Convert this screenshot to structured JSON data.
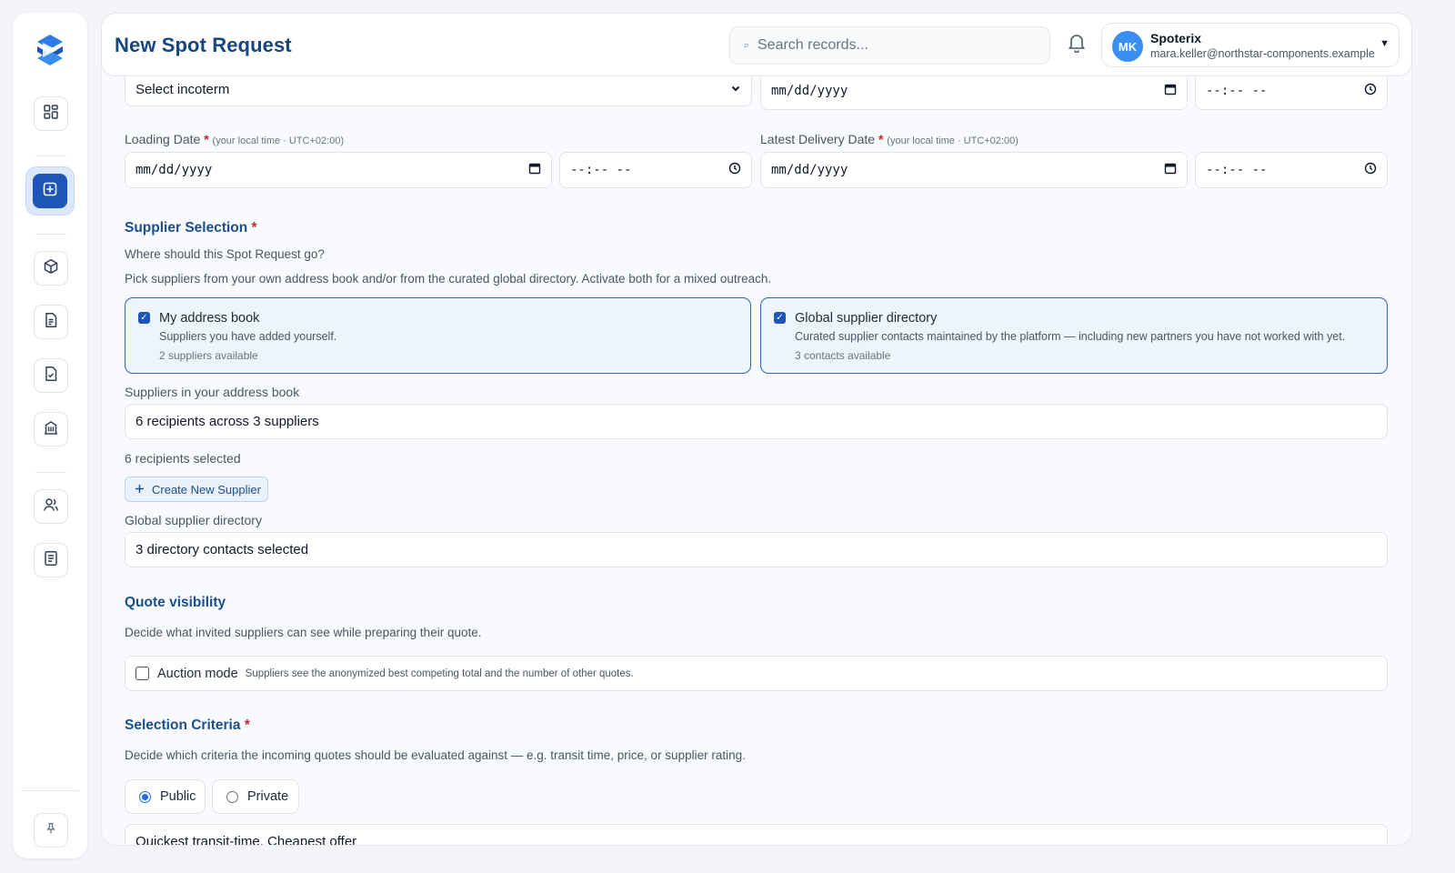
{
  "header": {
    "title": "New Spot Request",
    "search_placeholder": "Search records...",
    "user": {
      "initials": "MK",
      "name": "Spoterix",
      "email": "mara.keller@northstar-components.example"
    }
  },
  "sidebar": {
    "items": [
      {
        "icon": "dashboard-icon"
      },
      {
        "icon": "new-request-icon",
        "active": true
      },
      {
        "icon": "package-icon"
      },
      {
        "icon": "document-icon"
      },
      {
        "icon": "document-check-icon"
      },
      {
        "icon": "building-icon"
      },
      {
        "icon": "users-icon"
      },
      {
        "icon": "list-icon"
      },
      {
        "icon": "pin-icon"
      }
    ]
  },
  "form": {
    "incoterm_placeholder": "Select incoterm",
    "date_placeholder": "mm/dd/yyyy",
    "time_placeholder": "--:-- --",
    "loading_date_label": "Loading Date",
    "latest_delivery_label": "Latest Delivery Date",
    "required_mark": "*",
    "timezone_note": "(your local time · UTC+02:00)",
    "supplier_selection": {
      "title": "Supplier Selection",
      "question": "Where should this Spot Request go?",
      "help": "Pick suppliers from your own address book and/or from the curated global directory. Activate both for a mixed outreach.",
      "address_book": {
        "title": "My address book",
        "subtitle": "Suppliers you have added yourself.",
        "count": "2 suppliers available",
        "checked": true
      },
      "global_directory": {
        "title": "Global supplier directory",
        "subtitle": "Curated supplier contacts maintained by the platform — including new partners you have not worked with yet.",
        "count": "3 contacts available",
        "checked": true
      },
      "address_book_label": "Suppliers in your address book",
      "address_book_value": "6 recipients across 3 suppliers",
      "recipients_selected": "6 recipients selected",
      "create_supplier_label": "Create New Supplier",
      "directory_label": "Global supplier directory",
      "directory_value": "3 directory contacts selected"
    },
    "quote_visibility": {
      "title": "Quote visibility",
      "help": "Decide what invited suppliers can see while preparing their quote.",
      "auction_label": "Auction mode",
      "auction_help": "Suppliers see the anonymized best competing total and the number of other quotes.",
      "auction_checked": false
    },
    "selection_criteria": {
      "title": "Selection Criteria",
      "help": "Decide which criteria the incoming quotes should be evaluated against — e.g. transit time, price, or supplier rating.",
      "options": [
        "Public",
        "Private"
      ],
      "selected": "Public",
      "criteria_value": "Quickest transit-time, Cheapest offer"
    }
  }
}
